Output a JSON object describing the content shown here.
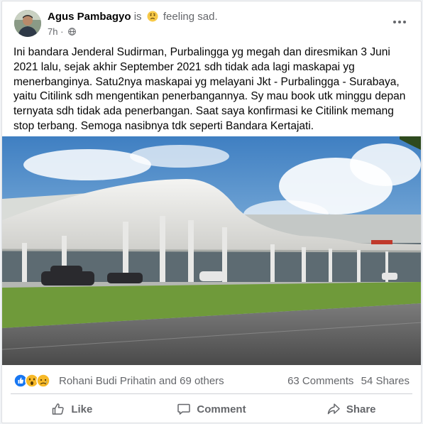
{
  "post": {
    "author": "Agus Pambagyo",
    "is_word": "is",
    "feeling": "feeling sad.",
    "feeling_icon": "sad-face-icon",
    "time": "7h",
    "separator": "·",
    "privacy_icon": "globe-icon",
    "text_lines": [
      "Ini bandara Jenderal Sudirman, Purbalingga yg megah dan diresmikan 3 Juni",
      "2021 lalu, sejak akhir September 2021 sdh tidak ada lagi maskapai yg",
      "menerbanginya. Satu2nya maskapai yg melayani Jkt - Purbalingga - Surabaya,",
      "yaitu Citilink sdh mengentikan penerbangannya. Sy mau book utk minggu depan",
      "ternyata sdh tidak ada penerbangan.  Saat saya konfirmasi ke Citilink memang",
      "stop terbang. Semoga nasibnya tdk seperti Bandara Kertajati."
    ]
  },
  "reactions": {
    "icons": [
      "like-icon",
      "wow-icon",
      "sad-icon"
    ],
    "reactors": "Rohani Budi Prihatin and 69 others",
    "comments": "63 Comments",
    "shares": "54 Shares"
  },
  "actions": {
    "like": "Like",
    "comment": "Comment",
    "share": "Share"
  },
  "colors": {
    "text_primary": "#050505",
    "text_secondary": "#65676b",
    "like_blue": "#1877f2",
    "reaction_yellow": "#f7b928",
    "divider": "#ced0d4"
  }
}
